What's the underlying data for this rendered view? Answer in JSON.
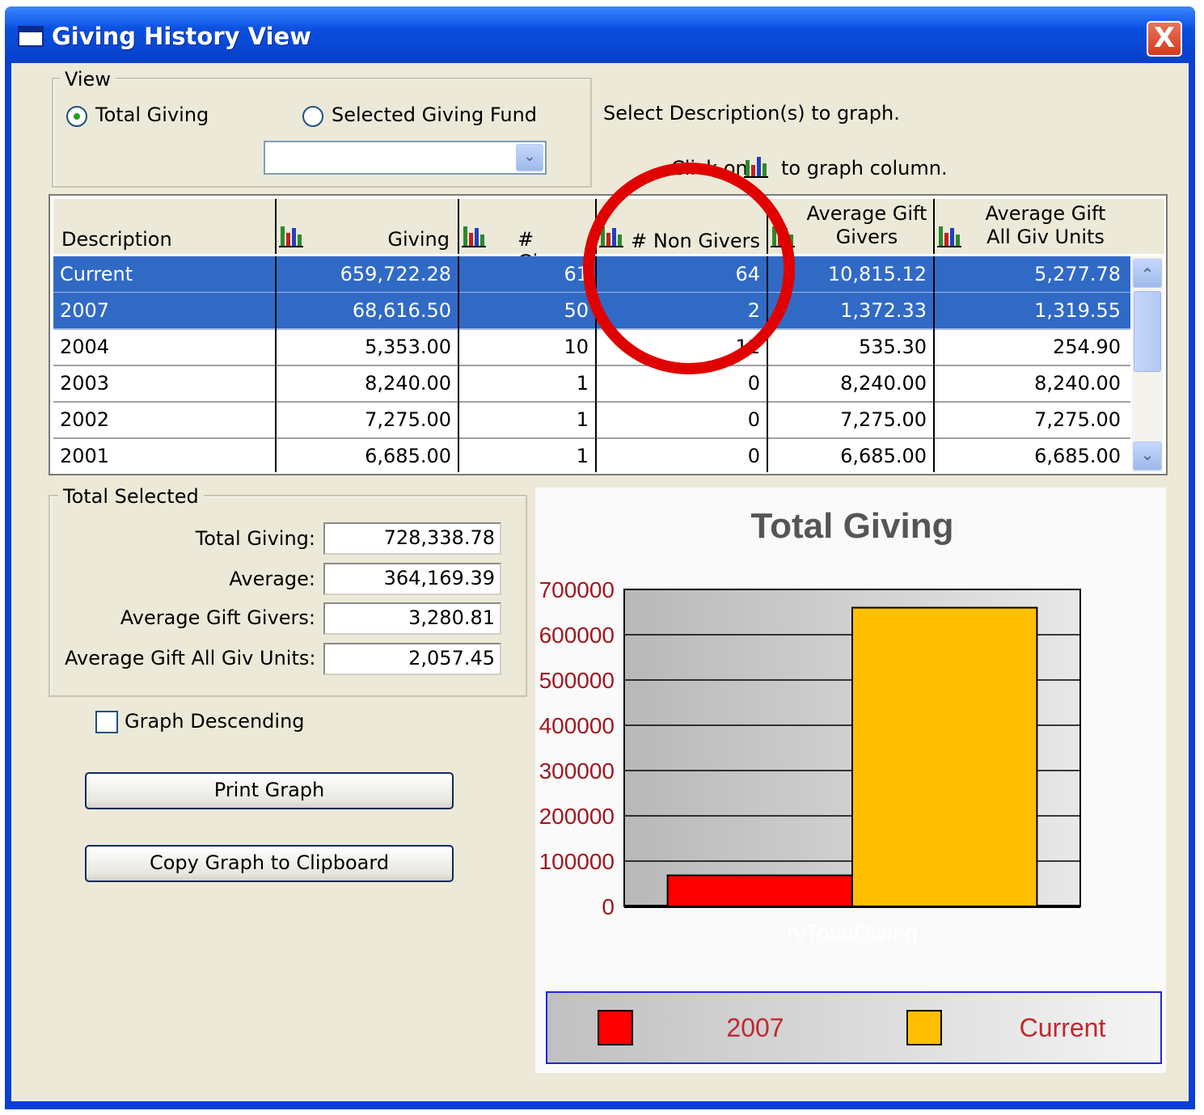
{
  "window": {
    "title": "Giving History View",
    "close_label": "X"
  },
  "view_group": {
    "legend": "View",
    "options": [
      {
        "label": "Total Giving",
        "selected": true
      },
      {
        "label": "Selected Giving Fund",
        "selected": false
      }
    ],
    "fund_select_value": "",
    "hint_select": "Select Description(s) to graph.",
    "hint_click_prefix": "Click on",
    "hint_click_suffix": "to graph column."
  },
  "grid": {
    "columns": [
      {
        "label": "Description"
      },
      {
        "label": "Giving"
      },
      {
        "label": "# Givers"
      },
      {
        "label": "# Non Givers"
      },
      {
        "label": "Average Gift Givers",
        "line1": "Average Gift",
        "line2": "Givers"
      },
      {
        "label": "Average Gift All Giv Units",
        "line1": "Average Gift",
        "line2": "All Giv Units"
      }
    ],
    "rows": [
      {
        "desc": "Current",
        "giving": "659,722.28",
        "givers": "61",
        "non_givers": "64",
        "avg_givers": "10,815.12",
        "avg_all": "5,277.78",
        "selected": true
      },
      {
        "desc": "2007",
        "giving": "68,616.50",
        "givers": "50",
        "non_givers": "2",
        "avg_givers": "1,372.33",
        "avg_all": "1,319.55",
        "selected": true
      },
      {
        "desc": "2004",
        "giving": "5,353.00",
        "givers": "10",
        "non_givers": "11",
        "avg_givers": "535.30",
        "avg_all": "254.90",
        "selected": false
      },
      {
        "desc": "2003",
        "giving": "8,240.00",
        "givers": "1",
        "non_givers": "0",
        "avg_givers": "8,240.00",
        "avg_all": "8,240.00",
        "selected": false
      },
      {
        "desc": "2002",
        "giving": "7,275.00",
        "givers": "1",
        "non_givers": "0",
        "avg_givers": "7,275.00",
        "avg_all": "7,275.00",
        "selected": false
      },
      {
        "desc": "2001",
        "giving": "6,685.00",
        "givers": "1",
        "non_givers": "0",
        "avg_givers": "6,685.00",
        "avg_all": "6,685.00",
        "selected": false
      }
    ]
  },
  "total_selected": {
    "legend": "Total Selected",
    "fields": [
      {
        "label": "Total Giving:",
        "value": "728,338.78"
      },
      {
        "label": "Average:",
        "value": "364,169.39"
      },
      {
        "label": "Average Gift Givers:",
        "value": "3,280.81"
      },
      {
        "label": "Average Gift All Giv Units:",
        "value": "2,057.45"
      }
    ]
  },
  "options": {
    "graph_descending_label": "Graph Descending",
    "graph_descending_checked": false
  },
  "buttons": {
    "print_graph": "Print Graph",
    "copy_graph": "Copy Graph to Clipboard"
  },
  "colors": {
    "selection": "#316ac5",
    "bar_2007": "#ff0000",
    "bar_current": "#ffbf00",
    "annotation_circle": "#e00000",
    "titlebar": "#0a4fe0"
  },
  "chart_data": {
    "type": "bar",
    "title": "Total Giving",
    "xlabel": "rvTotalGiving",
    "ylabel": "",
    "ylim": [
      0,
      700000
    ],
    "yticks": [
      0,
      100000,
      200000,
      300000,
      400000,
      500000,
      600000,
      700000
    ],
    "grid": true,
    "legend_position": "bottom",
    "series": [
      {
        "name": "2007",
        "value": 68616.5,
        "color": "#ff0000"
      },
      {
        "name": "Current",
        "value": 659722.28,
        "color": "#ffbf00"
      }
    ]
  }
}
